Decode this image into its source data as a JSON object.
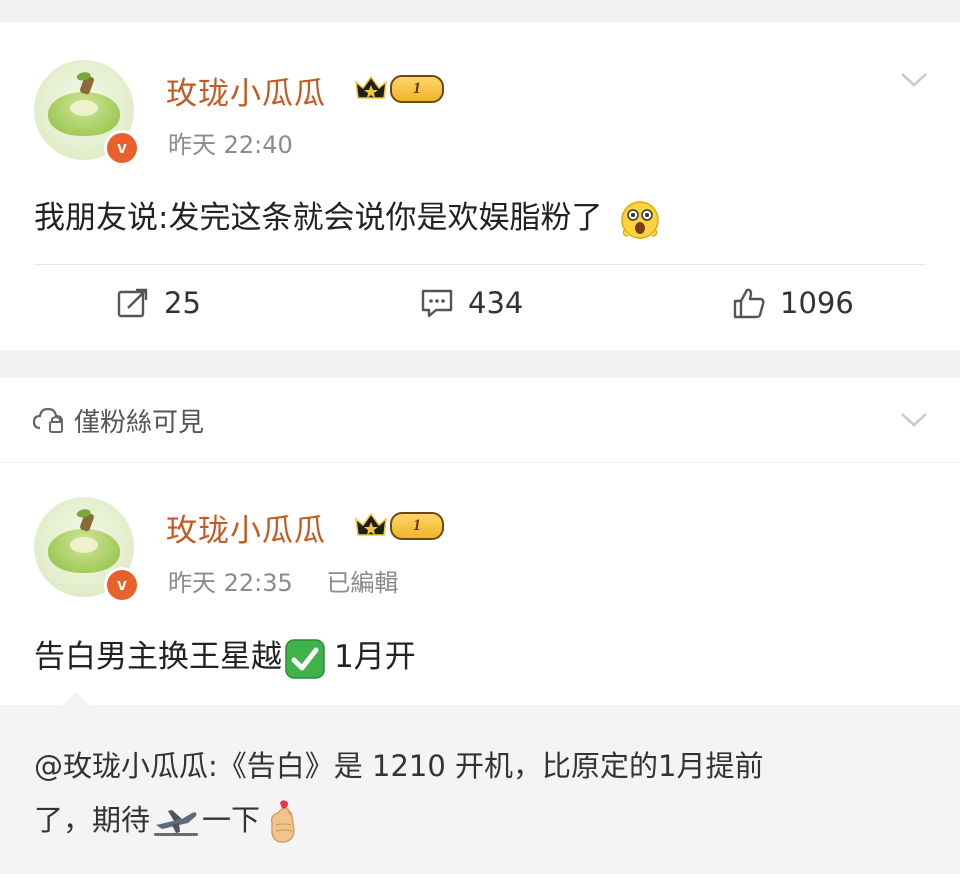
{
  "post1": {
    "author": "玫珑小瓜瓜",
    "level": "1",
    "time": "昨天 22:40",
    "text": "我朋友说:发完这条就会说你是欢娱脂粉了",
    "emoji": "surprised-face-emoji",
    "actions": {
      "repost_count": "25",
      "comment_count": "434",
      "like_count": "1096"
    }
  },
  "visibility": {
    "label": "僅粉絲可見"
  },
  "post2": {
    "author": "玫珑小瓜瓜",
    "level": "1",
    "time": "昨天 22:35",
    "edited": "已編輯",
    "text_before": "告白男主换王星越",
    "text_after": "1月开",
    "emoji": "check-mark-button-emoji",
    "quote": {
      "line1": "@玫珑小瓜瓜:《告白》是 1210 开机，比原定的1月提前",
      "line2_a": "了，期待",
      "line2_b": "一下",
      "emojis": [
        "airplane-departure-emoji",
        "finger-heart-emoji"
      ]
    }
  },
  "colors": {
    "name": "#c35b25",
    "verified_badge": "#e8602c",
    "meta": "#8b8b8b",
    "background": "#f2f2f2"
  }
}
